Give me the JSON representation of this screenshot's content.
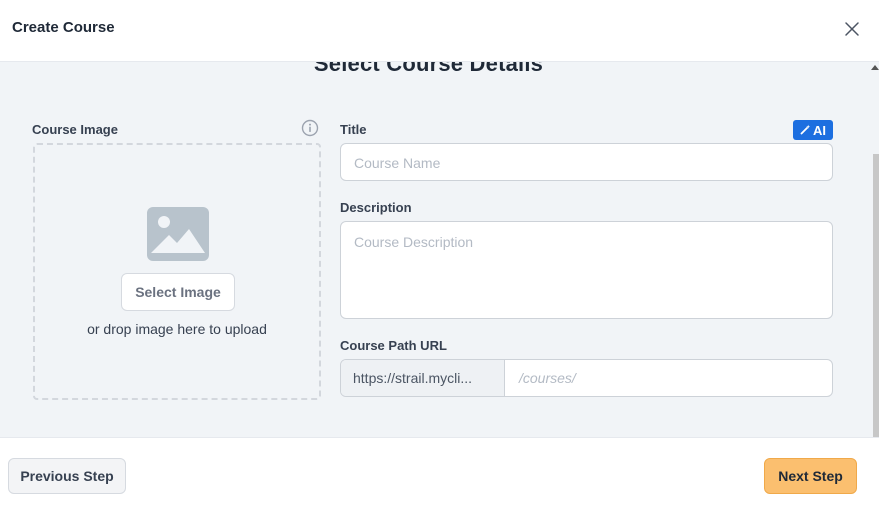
{
  "modal": {
    "title": "Create Course",
    "close_icon": "close-icon"
  },
  "step": {
    "heading": "Select Course Details"
  },
  "course_image": {
    "label": "Course Image",
    "info_icon": "info-icon",
    "placeholder_icon": "image-placeholder-icon",
    "select_button": "Select Image",
    "drop_text": "or drop image here to upload"
  },
  "title_field": {
    "label": "Title",
    "ai_badge": "AI",
    "ai_icon": "magic-wand-icon",
    "placeholder": "Course Name",
    "value": ""
  },
  "description_field": {
    "label": "Description",
    "placeholder": "Course Description",
    "value": ""
  },
  "url_field": {
    "label": "Course Path URL",
    "prefix": "https://strail.mycli...",
    "placeholder": "/courses/",
    "value": ""
  },
  "footer": {
    "previous_label": "Previous Step",
    "next_label": "Next Step"
  },
  "colors": {
    "accent_blue": "#1d6fe0",
    "next_button": "#fbbf6f",
    "background": "#f1f4f7"
  }
}
